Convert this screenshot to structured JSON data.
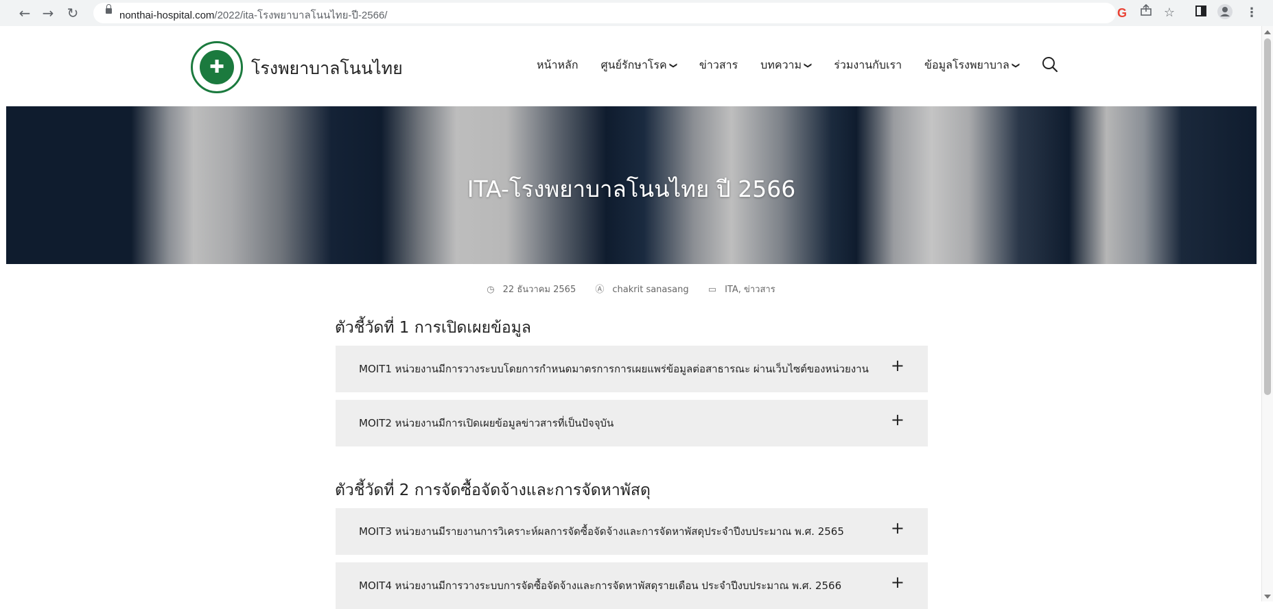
{
  "browser": {
    "url_host": "nonthai-hospital.com",
    "url_path": "/2022/ita-โรงพยาบาลโนนไทย-ปี-2566/",
    "icons": [
      "back-arrow-icon",
      "forward-arrow-icon",
      "reload-icon",
      "lock-icon",
      "google-icon",
      "share-icon",
      "star-icon",
      "sidebar-icon",
      "profile-icon",
      "menu-dots-icon"
    ]
  },
  "site": {
    "title": "โรงพยาบาลโนนไทย",
    "nav": [
      {
        "label": "หน้าหลัก",
        "dropdown": false
      },
      {
        "label": "ศูนย์รักษาโรค",
        "dropdown": true
      },
      {
        "label": "ข่าวสาร",
        "dropdown": false
      },
      {
        "label": "บทความ",
        "dropdown": true
      },
      {
        "label": "ร่วมงานกับเรา",
        "dropdown": false
      },
      {
        "label": "ข้อมูลโรงพยาบาล",
        "dropdown": true
      }
    ]
  },
  "hero": {
    "title": "ITA-โรงพยาบาลโนนไทย ปี 2566"
  },
  "meta": {
    "date": "22 ธันวาคม 2565",
    "author": "chakrit sanasang",
    "categories": "ITA, ข่าวสาร"
  },
  "sections": [
    {
      "heading": "ตัวชี้วัดที่ 1 การเปิดเผยข้อมูล",
      "items": [
        "MOIT1 หน่วยงานมีการวางระบบโดยการกำหนดมาตรการการเผยแพร่ข้อมูลต่อสาธารณะ ผ่านเว็บไซต์ของหน่วยงาน",
        "MOIT2 หน่วยงานมีการเปิดเผยข้อมูลข่าวสารที่เป็นปัจจุบัน"
      ]
    },
    {
      "heading": "ตัวชี้วัดที่ 2 การจัดซื้อจัดจ้างและการจัดหาพัสดุ",
      "items": [
        "MOIT3 หน่วยงานมีรายงานการวิเคราะห์ผลการจัดซื้อจัดจ้างและการจัดหาพัสดุประจำปีงบประมาณ พ.ศ. 2565",
        "MOIT4 หน่วยงานมีการวางระบบการจัดซื้อจัดจ้างและการจัดหาพัสดุรายเดือน ประจำปีงบประมาณ พ.ศ. 2566"
      ]
    }
  ],
  "accordion_toggle": "+"
}
